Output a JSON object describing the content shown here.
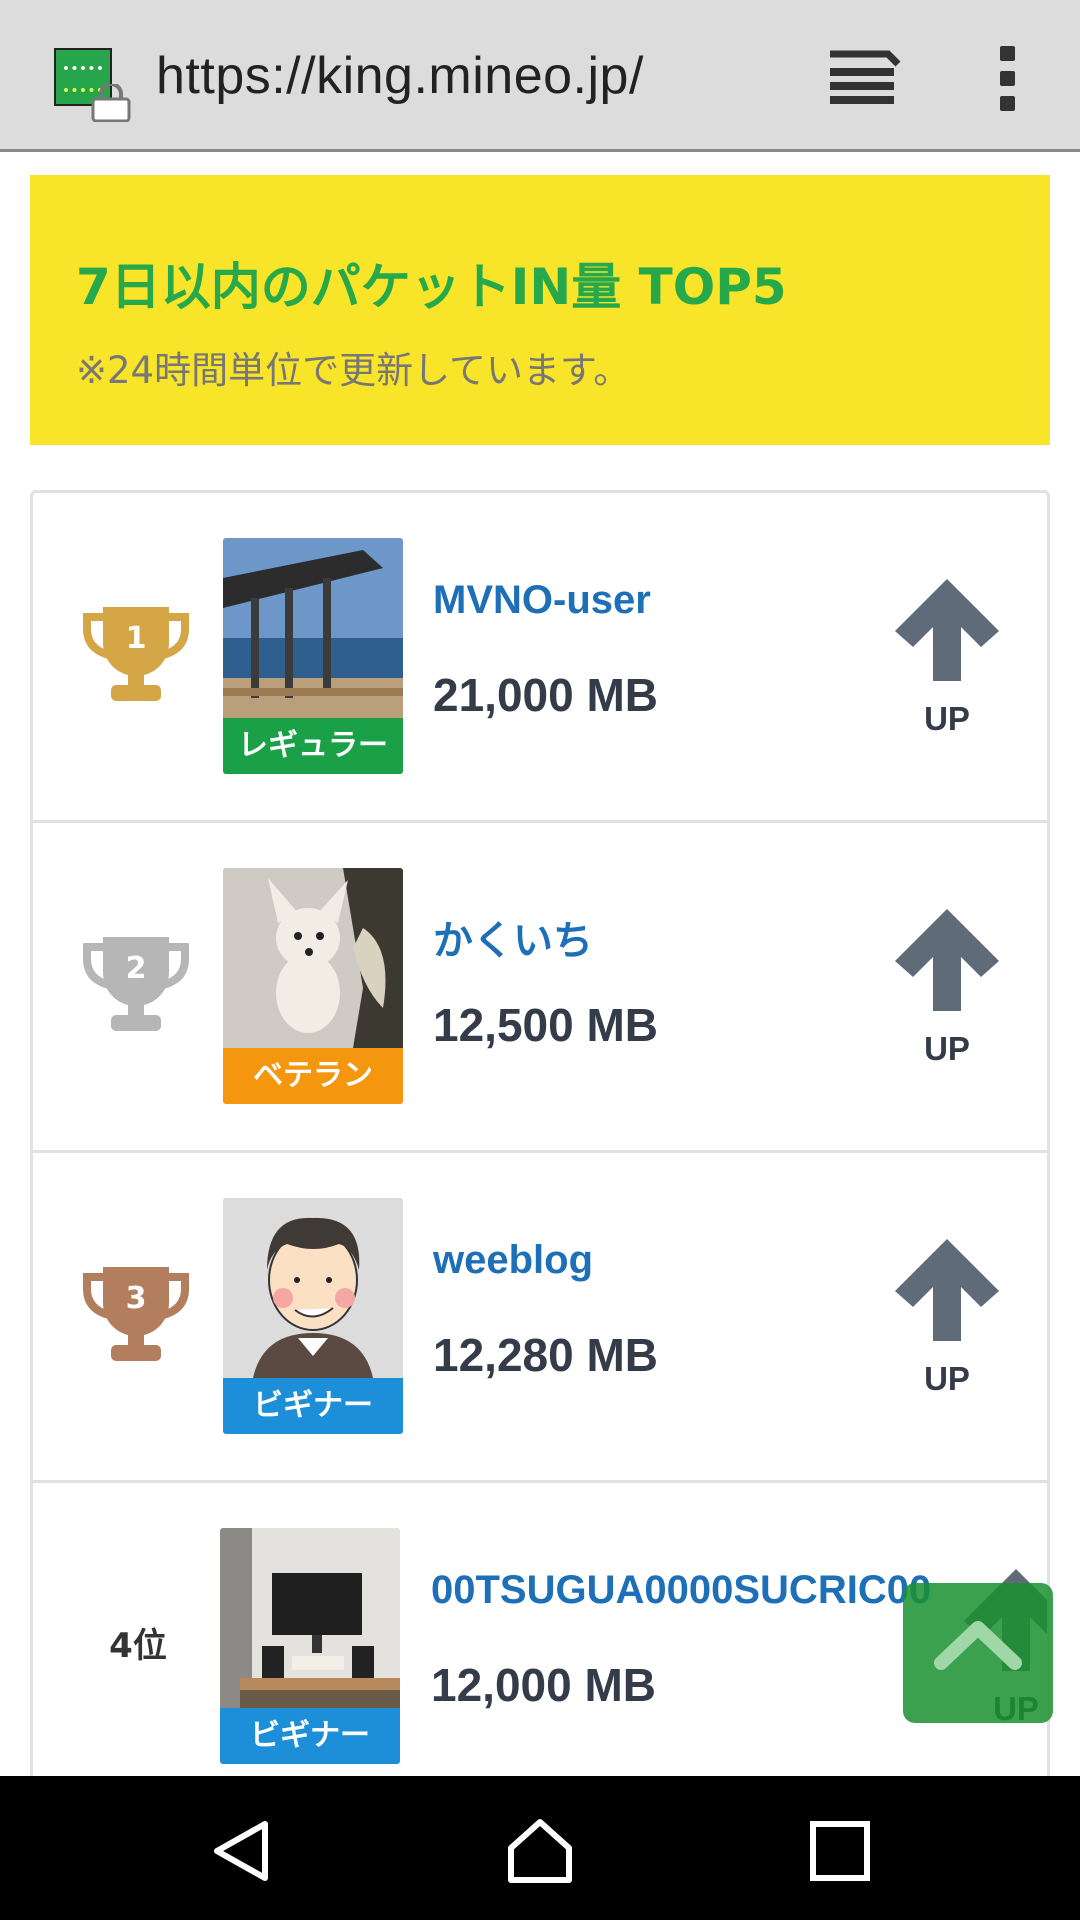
{
  "browser": {
    "url": "https://king.mineo.jp/",
    "favicon_icon": "mineo-logo",
    "lock_icon": "lock-icon",
    "tabs_icon": "tabs-icon",
    "menu_icon": "more-vert-icon"
  },
  "banner": {
    "title": "7日以内のパケットIN量 TOP5",
    "note": "※24時間単位で更新しています。",
    "bg_color": "#f8e52a",
    "title_color": "#27a84a"
  },
  "ranking": [
    {
      "rank": "1",
      "rank_icon": "gold-trophy-icon",
      "username": "MVNO-user",
      "amount": "21,000 MB",
      "badge": "レギュラー",
      "badge_color": "#1aa046",
      "up_label": "UP"
    },
    {
      "rank": "2",
      "rank_icon": "silver-trophy-icon",
      "username": "かくいち",
      "amount": "12,500 MB",
      "badge": "ベテラン",
      "badge_color": "#f5960f",
      "up_label": "UP"
    },
    {
      "rank": "3",
      "rank_icon": "bronze-trophy-icon",
      "username": "weeblog",
      "amount": "12,280 MB",
      "badge": "ビギナー",
      "badge_color": "#1d8fd8",
      "up_label": "UP"
    },
    {
      "rank": "4位",
      "rank_icon": "",
      "username": "00TSUGUA0000SUCRIC00",
      "amount": "12,000 MB",
      "badge": "ビギナー",
      "badge_color": "#1d8fd8",
      "up_label": "UP"
    }
  ],
  "colors": {
    "gold": "#d4a646",
    "silver": "#b6b6b6",
    "bronze": "#b27e5e",
    "up_arrow": "#5f6b78",
    "username": "#1d6fb8"
  },
  "floating": {
    "scroll_top_icon": "chevron-up-icon"
  },
  "navbar": {
    "back_icon": "back-triangle-icon",
    "home_icon": "home-icon",
    "recents_icon": "recents-square-icon"
  }
}
